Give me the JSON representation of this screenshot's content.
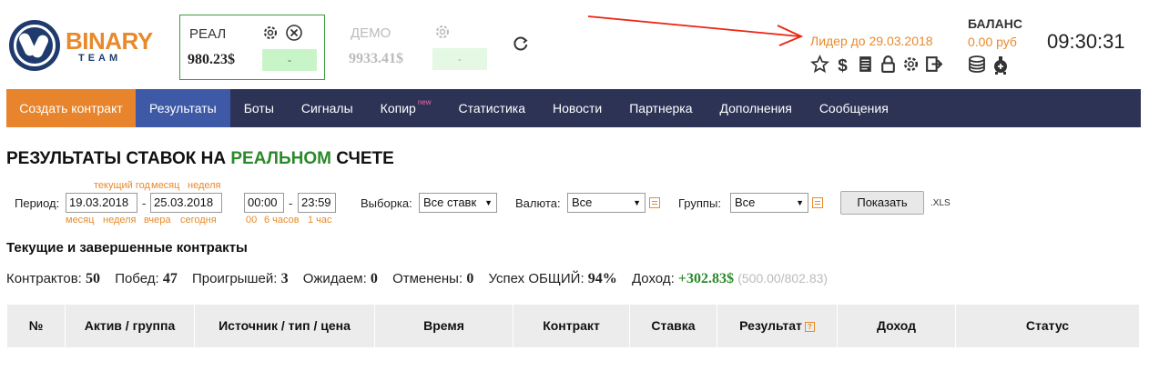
{
  "logo": {
    "brand": "BINARY",
    "sub": "TEAM"
  },
  "accounts": {
    "real": {
      "label": "РЕАЛ",
      "amount": "980.23$",
      "bar": "-"
    },
    "demo": {
      "label": "ДЕМО",
      "amount": "9933.41$",
      "bar": "-"
    }
  },
  "user": {
    "leader_text": "Лидер до 29.03.2018",
    "icons": [
      "star-icon",
      "dollar-icon",
      "document-icon",
      "lock-icon",
      "gear-icon",
      "logout-icon"
    ]
  },
  "balance": {
    "title": "БАЛАНС",
    "value": "0.00 руб",
    "icons": [
      "coins-icon",
      "piggy-bank-icon"
    ]
  },
  "clock": "09:30:31",
  "nav": {
    "items": [
      {
        "label": "Создать контракт"
      },
      {
        "label": "Результаты"
      },
      {
        "label": "Боты"
      },
      {
        "label": "Сигналы"
      },
      {
        "label": "Копир",
        "badge": "new"
      },
      {
        "label": "Статистика"
      },
      {
        "label": "Новости"
      },
      {
        "label": "Партнерка"
      },
      {
        "label": "Дополнения"
      },
      {
        "label": "Сообщения"
      }
    ]
  },
  "page_title": {
    "prefix": "РЕЗУЛЬТАТЫ СТАВОК НА",
    "highlight": "РЕАЛЬНОМ",
    "suffix": "СЧЕТЕ"
  },
  "filters": {
    "period_label": "Период:",
    "date_from": "19.03.2018",
    "date_to": "25.03.2018",
    "date_shortcuts_top": [
      "текущий год",
      "месяц",
      "неделя"
    ],
    "date_shortcuts_bottom": [
      "месяц",
      "неделя",
      "вчера",
      "сегодня"
    ],
    "time_from": "00:00",
    "time_to": "23:59",
    "time_shortcuts": [
      "00",
      "6 часов",
      "1 час"
    ],
    "selection_label": "Выборка:",
    "selection_value": "Все ставк",
    "currency_label": "Валюта:",
    "currency_value": "Все",
    "groups_label": "Группы:",
    "groups_value": "Все",
    "show_button": "Показать",
    "xls": ".XLS"
  },
  "section_title": "Текущие и завершенные контракты",
  "stats": {
    "contracts_label": "Контрактов:",
    "contracts": "50",
    "wins_label": "Побед:",
    "wins": "47",
    "losses_label": "Проигрышей:",
    "losses": "3",
    "pending_label": "Ожидаем:",
    "pending": "0",
    "cancelled_label": "Отменены:",
    "cancelled": "0",
    "success_label": "Успех ОБЩИЙ:",
    "success": "94%",
    "income_label": "Доход:",
    "income": "+302.83$",
    "income_detail": "(500.00/802.83)"
  },
  "table": {
    "columns": [
      "№",
      "Актив / группа",
      "Источник / тип / цена",
      "Время",
      "Контракт",
      "Ставка",
      "Результат",
      "Доход",
      "Статус"
    ]
  },
  "colors": {
    "accent": "#e8842b",
    "nav_bg": "#2c3355",
    "nav_active": "#3e59a6",
    "profit": "#2a8a2a"
  }
}
